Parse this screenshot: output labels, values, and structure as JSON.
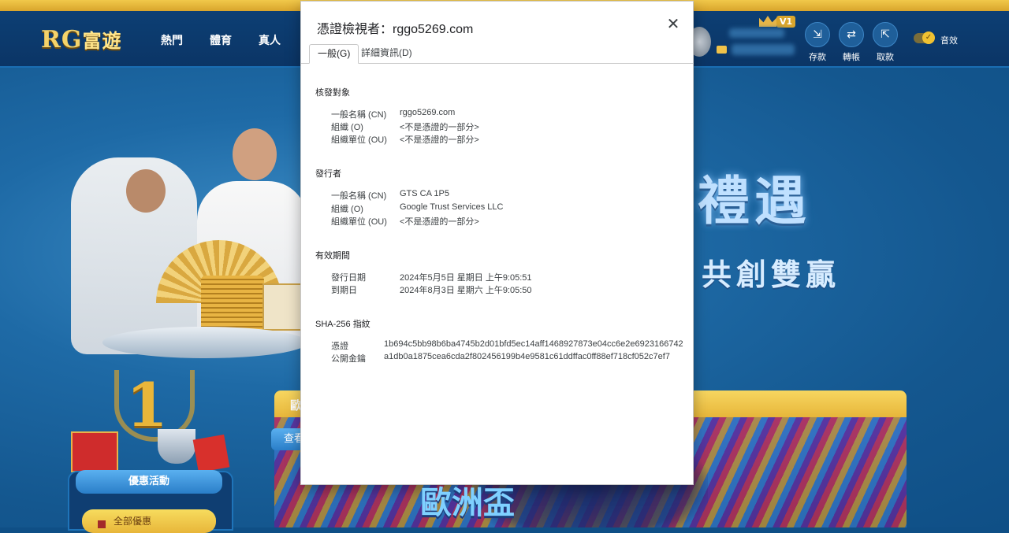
{
  "site": {
    "logo_text": "RG",
    "logo_cn": "富遊",
    "nav": [
      "熱門",
      "體育",
      "真人"
    ],
    "vip_level": "V1",
    "actions": [
      {
        "label": "存款",
        "icon": "deposit-icon"
      },
      {
        "label": "轉帳",
        "icon": "transfer-icon"
      },
      {
        "label": "取款",
        "icon": "withdraw-icon"
      }
    ],
    "sound_label": "音效"
  },
  "banner": {
    "slogan_line1": "禮遇",
    "slogan_line2": "共創雙贏",
    "rank": "1"
  },
  "promo": {
    "tab_label": "優惠活動",
    "item_label": "全部優惠"
  },
  "euro": {
    "title": "歐",
    "view_label": "查看",
    "big_text": "歐洲盃"
  },
  "dialog": {
    "title": "憑證檢視者：rggo5269.com",
    "tabs": [
      "一般(G)",
      "詳細資訊(D)"
    ],
    "issued_to": {
      "heading": "核發對象",
      "rows": [
        {
          "label": "一般名稱 (CN)",
          "value": "rggo5269.com"
        },
        {
          "label": "組織 (O)",
          "value": "<不是憑證的一部分>"
        },
        {
          "label": "組織單位 (OU)",
          "value": "<不是憑證的一部分>"
        }
      ]
    },
    "issuer": {
      "heading": "發行者",
      "rows": [
        {
          "label": "一般名稱 (CN)",
          "value": "GTS CA 1P5"
        },
        {
          "label": "組織 (O)",
          "value": "Google Trust Services LLC"
        },
        {
          "label": "組織單位 (OU)",
          "value": "<不是憑證的一部分>"
        }
      ]
    },
    "validity": {
      "heading": "有效期間",
      "rows": [
        {
          "label": "發行日期",
          "value": "2024年5月5日 星期日 上午9:05:51"
        },
        {
          "label": "到期日",
          "value": "2024年8月3日 星期六 上午9:05:50"
        }
      ]
    },
    "fingerprints": {
      "heading": "SHA-256 指紋",
      "rows": [
        {
          "label": "憑證",
          "value": "1b694c5bb98b6ba4745b2d01bfd5ec14aff1468927873e04cc6e2e6923166742"
        },
        {
          "label": "公開金鑰",
          "value": "a1db0a1875cea6cda2f802456199b4e9581c61ddffac0ff88ef718cf052c7ef7"
        }
      ]
    }
  }
}
